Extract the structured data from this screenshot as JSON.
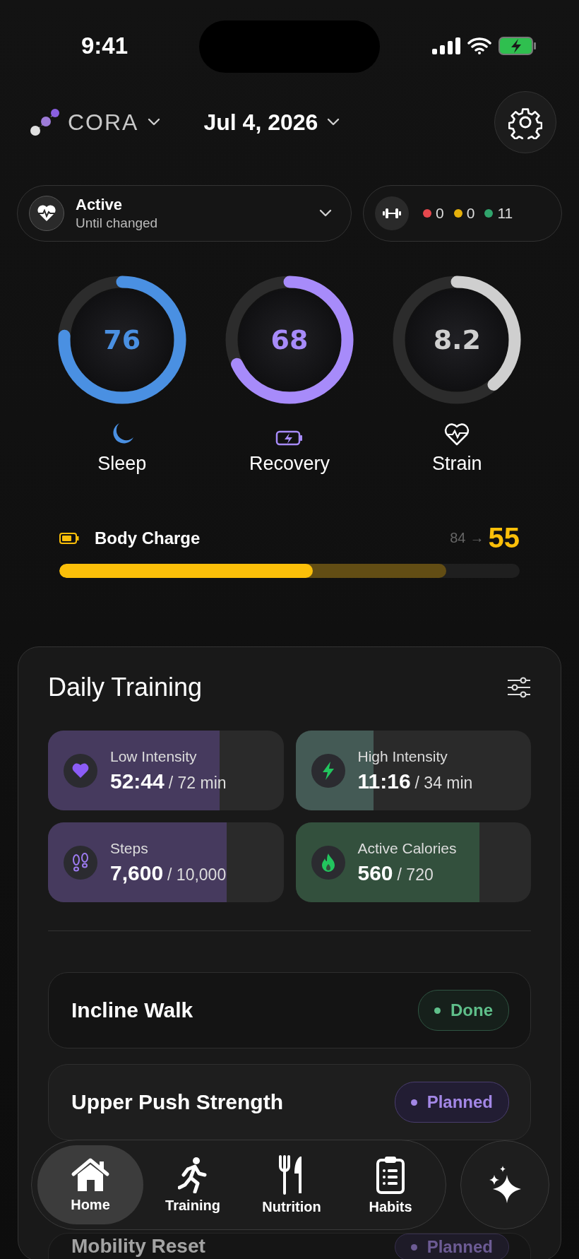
{
  "status_bar": {
    "time": "9:41"
  },
  "header": {
    "brand": "CORA",
    "date": "Jul 4, 2026"
  },
  "mode": {
    "title": "Active",
    "subtitle": "Until changed"
  },
  "counters": [
    {
      "count": "0",
      "color": "#e5484d"
    },
    {
      "count": "0",
      "color": "#e5b00b"
    },
    {
      "count": "11",
      "color": "#30a46c"
    }
  ],
  "rings": [
    {
      "value": "76",
      "label": "Sleep",
      "kind": "sleep",
      "level": 0.76,
      "color": "#4a90e2"
    },
    {
      "value": "68",
      "label": "Recovery",
      "kind": "recovery",
      "level": 0.68,
      "color": "#a78bfa"
    },
    {
      "value": "8.2",
      "label": "Strain",
      "kind": "strain",
      "level": 0.39,
      "color": "#cfcfcf"
    }
  ],
  "body_charge": {
    "label": "Body Charge",
    "start": "84",
    "arrow": "→",
    "value": "55",
    "level": 0.55,
    "projection": {
      "level": 0.84
    }
  },
  "daily_training": {
    "title": "Daily Training",
    "tiles": [
      {
        "label": "Low Intensity",
        "value": "52:44",
        "target": "/ 72 min",
        "kind": "heart",
        "level": 0.73,
        "color": "#463a5e"
      },
      {
        "label": "High Intensity",
        "value": "11:16",
        "target": "/ 34 min",
        "kind": "bolt",
        "level": 0.33,
        "color": "#445a55"
      },
      {
        "label": "Steps",
        "value": "7,600",
        "target": "/ 10,000",
        "kind": "steps",
        "level": 0.76,
        "color": "#463a5e"
      },
      {
        "label": "Active Calories",
        "value": "560",
        "target": "/ 720",
        "kind": "flame",
        "level": 0.78,
        "color": "#33503d"
      }
    ],
    "workouts": [
      {
        "name": "Incline Walk",
        "kind": "done",
        "badge": "Done"
      },
      {
        "name": "Upper Push Strength",
        "kind": "planned",
        "badge": "Planned"
      },
      {
        "name": "Mobility Reset",
        "kind": "planned",
        "badge": "Planned"
      }
    ]
  },
  "tab_bar": [
    {
      "label": "Home",
      "kind": "home",
      "selected": true
    },
    {
      "label": "Training",
      "kind": "run",
      "selected": false
    },
    {
      "label": "Nutrition",
      "kind": "food",
      "selected": false
    },
    {
      "label": "Habits",
      "kind": "list",
      "selected": false
    }
  ]
}
